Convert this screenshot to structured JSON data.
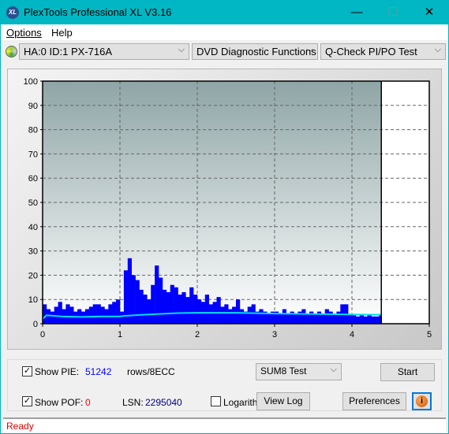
{
  "window": {
    "title": "PlexTools Professional XL V3.16",
    "logo_text": "XL",
    "minimize": "—",
    "maximize": "☐",
    "close": "✕"
  },
  "menu": [
    {
      "label": "Options"
    },
    {
      "label": "Help"
    }
  ],
  "toolbar": {
    "drive": "HA:0 ID:1  PX-716A",
    "function": "DVD Diagnostic Functions",
    "test": "Q-Check PI/PO Test",
    "chevron": "⌵"
  },
  "chart_data": {
    "type": "bar",
    "xlim": [
      0,
      5
    ],
    "ylim": [
      0,
      100
    ],
    "xticks": [
      "0",
      "1",
      "2",
      "3",
      "4",
      "5"
    ],
    "yticks": [
      "0",
      "10",
      "20",
      "30",
      "40",
      "50",
      "60",
      "70",
      "80",
      "90",
      "100"
    ],
    "grid": true,
    "end_marker_x": 4.38,
    "pie_x_step": 0.05,
    "pie_values": [
      8,
      6,
      5,
      7,
      9,
      6,
      8,
      7,
      5,
      6,
      5,
      6,
      7,
      8,
      8,
      7,
      6,
      8,
      9,
      10,
      5,
      22,
      27,
      20,
      18,
      14,
      12,
      10,
      16,
      24,
      19,
      14,
      13,
      16,
      15,
      12,
      13,
      11,
      15,
      12,
      10,
      9,
      12,
      8,
      9,
      11,
      7,
      8,
      6,
      7,
      10,
      6,
      5,
      7,
      8,
      5,
      6,
      5,
      4,
      5,
      5,
      4,
      6,
      4,
      5,
      4,
      5,
      6,
      4,
      5,
      4,
      5,
      4,
      6,
      5,
      4,
      5,
      8,
      8,
      4,
      4,
      3,
      4,
      3,
      4,
      3,
      3,
      4
    ],
    "avg_x": [
      0,
      0.05,
      0.25,
      0.5,
      0.75,
      1.0,
      1.05,
      1.25,
      1.5,
      1.75,
      2.0,
      2.5,
      3.0,
      3.5,
      4.0,
      4.38
    ],
    "avg_values": [
      2,
      3.5,
      3,
      2.8,
      3,
      3,
      3.2,
      3.6,
      4,
      4.4,
      4.5,
      4.5,
      4.2,
      4,
      3.8,
      3.7
    ],
    "colors": {
      "pie": "#0000ff",
      "avg": "#00e0f0",
      "plot_top": "#8fa5a6",
      "plot_bottom": "#ffffff"
    }
  },
  "panel": {
    "show_pie_label": "Show PIE:",
    "pie_value": "51242",
    "units": "rows/8ECC",
    "show_pof_label": "Show POF:",
    "pof_value": "0",
    "lsn_label": "LSN:",
    "lsn_value": "2295040",
    "logarithmic_label": "Logarithmic",
    "test_select": "SUM8 Test",
    "start": "Start",
    "view_log": "View Log",
    "preferences": "Preferences",
    "show_pie_checked": true,
    "show_pof_checked": true,
    "logarithmic_checked": false,
    "check": "✓",
    "info_icon": "i"
  },
  "status": "Ready"
}
